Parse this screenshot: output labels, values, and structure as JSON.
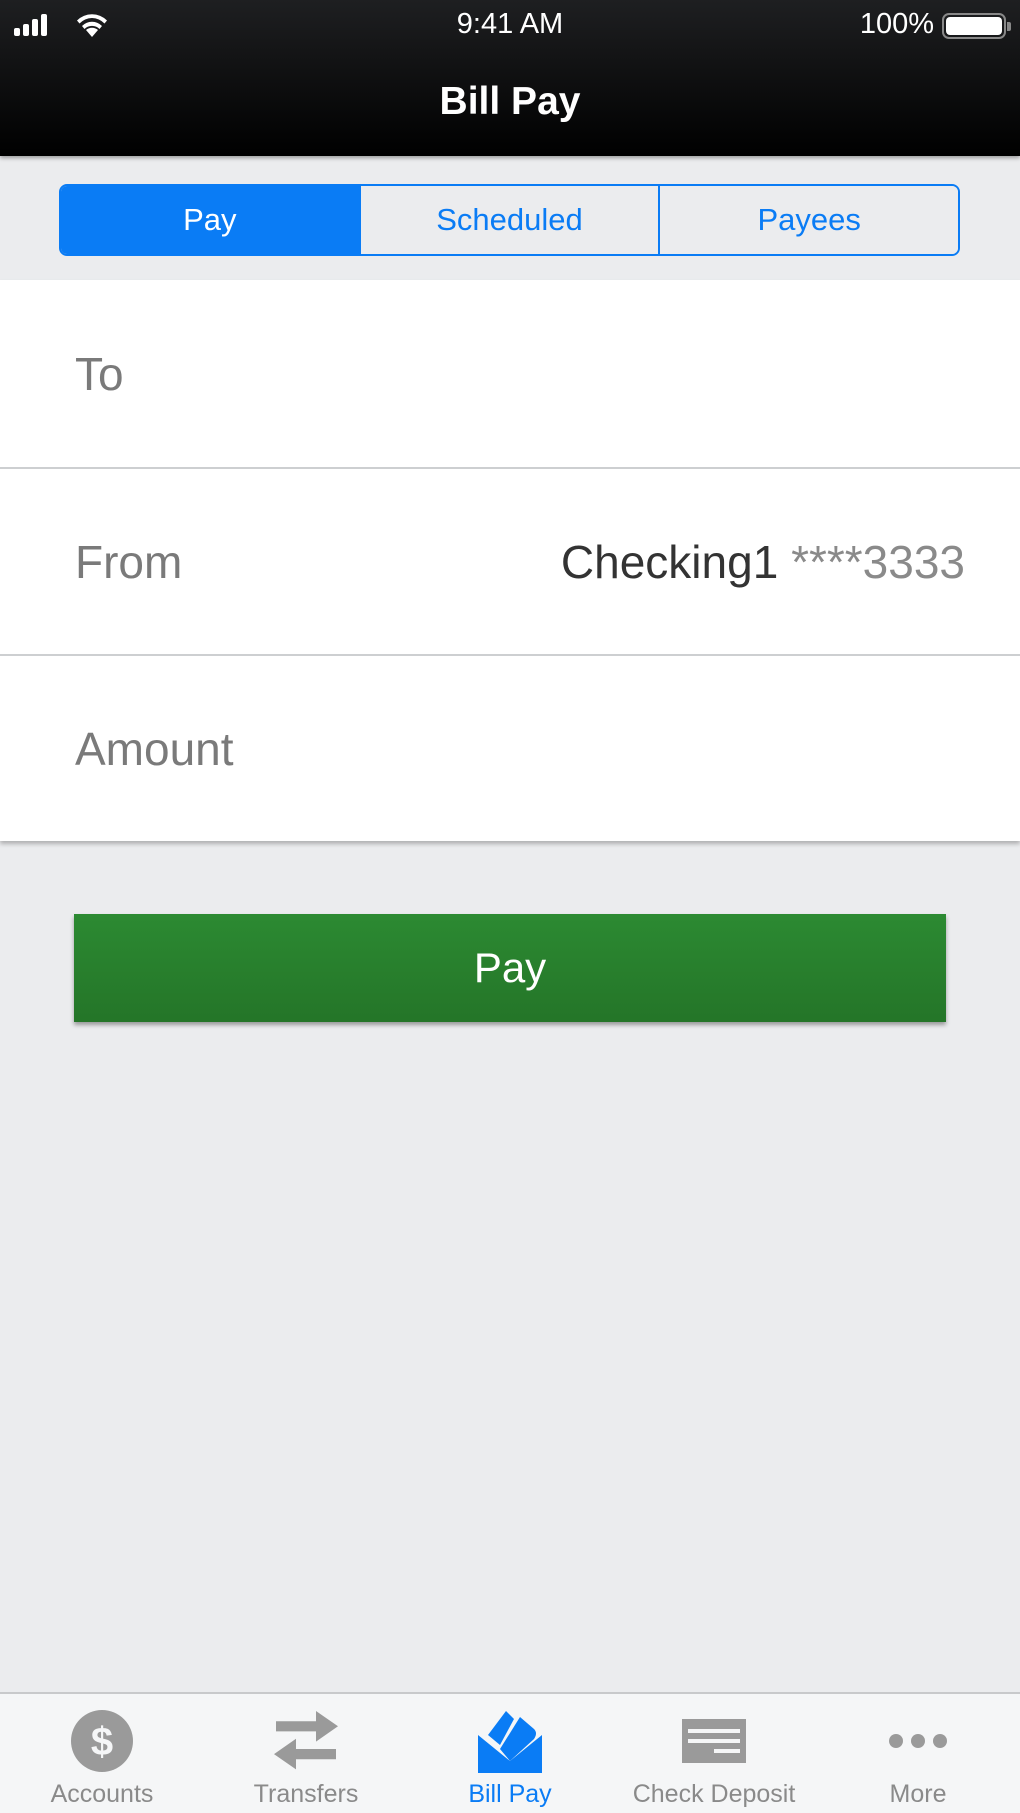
{
  "status_bar": {
    "time": "9:41 AM",
    "battery": "100%",
    "battery_level": 1.0,
    "signal_bars": 4
  },
  "header": {
    "title": "Bill Pay"
  },
  "segments": [
    {
      "label": "Pay",
      "active": true
    },
    {
      "label": "Scheduled",
      "active": false
    },
    {
      "label": "Payees",
      "active": false
    }
  ],
  "form": {
    "to": {
      "label": "To",
      "value": ""
    },
    "from": {
      "label": "From",
      "account": "Checking1",
      "mask": "****3333"
    },
    "amount": {
      "label": "Amount",
      "value": ""
    }
  },
  "pay_button": {
    "label": "Pay"
  },
  "tabbar": {
    "items": [
      {
        "label": "Accounts",
        "icon": "dollar-circle-icon",
        "active": false
      },
      {
        "label": "Transfers",
        "icon": "transfer-arrows-icon",
        "active": false
      },
      {
        "label": "Bill Pay",
        "icon": "bill-envelope-icon",
        "active": true
      },
      {
        "label": "Check Deposit",
        "icon": "check-icon",
        "active": false
      },
      {
        "label": "More",
        "icon": "more-dots-icon",
        "active": false
      }
    ]
  },
  "colors": {
    "accent": "#0a7cf5",
    "pay_green": "#2a8530",
    "inactive": "#9a9a9a"
  }
}
